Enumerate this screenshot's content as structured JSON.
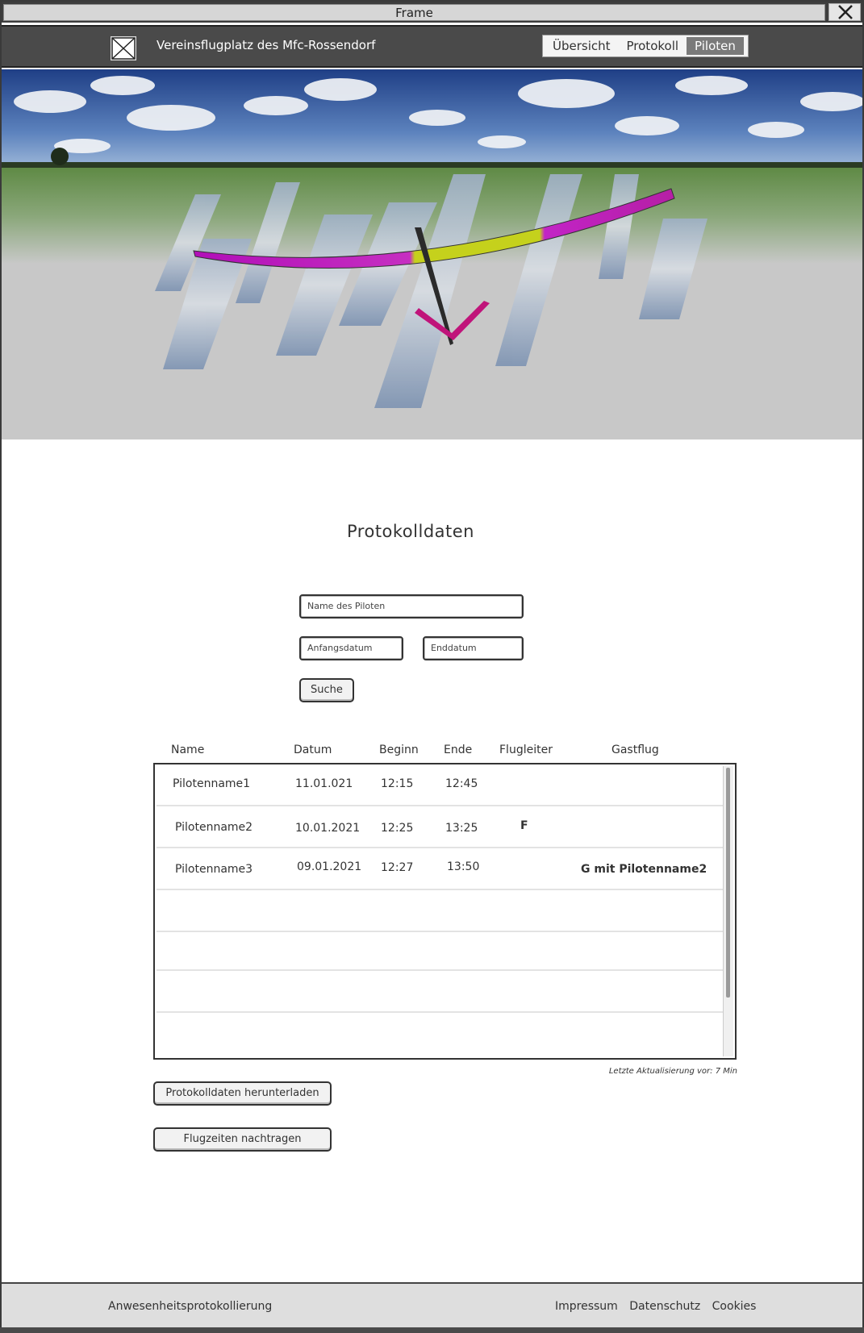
{
  "window": {
    "title": "Frame",
    "close_icon": "close-icon"
  },
  "header": {
    "logo_icon": "image-placeholder-icon",
    "site_title": "Vereinsflugplatz des Mfc-Rossendorf",
    "tabs": [
      {
        "label": "Übersicht",
        "active": false
      },
      {
        "label": "Protokoll",
        "active": false
      },
      {
        "label": "Piloten",
        "active": true
      }
    ]
  },
  "main": {
    "title": "Protokolldaten",
    "search": {
      "pilot_placeholder": "Name des Piloten",
      "start_placeholder": "Anfangsdatum",
      "end_placeholder": "Enddatum",
      "button_label": "Suche"
    },
    "table": {
      "columns": [
        "Name",
        "Datum",
        "Beginn",
        "Ende",
        "Flugleiter",
        "Gastflug"
      ],
      "rows": [
        {
          "name": "Pilotenname1",
          "datum": "11.01.021",
          "beginn": "12:15",
          "ende": "12:45",
          "flugleiter": "",
          "gastflug": ""
        },
        {
          "name": "Pilotenname2",
          "datum": "10.01.2021",
          "beginn": "12:25",
          "ende": "13:25",
          "flugleiter": "F",
          "gastflug": ""
        },
        {
          "name": "Pilotenname3",
          "datum": "09.01.2021",
          "beginn": "12:27",
          "ende": "13:50",
          "flugleiter": "",
          "gastflug": "G mit Pilotenname2"
        }
      ]
    },
    "update_note": "Letzte Aktualisierung vor: 7 Min",
    "download_button": "Protokolldaten herunterladen",
    "add_times_button": "Flugzeiten nachtragen"
  },
  "footer": {
    "left_text": "Anwesenheitsprotokollierung",
    "links": [
      "Impressum",
      "Datenschutz",
      "Cookies"
    ]
  }
}
